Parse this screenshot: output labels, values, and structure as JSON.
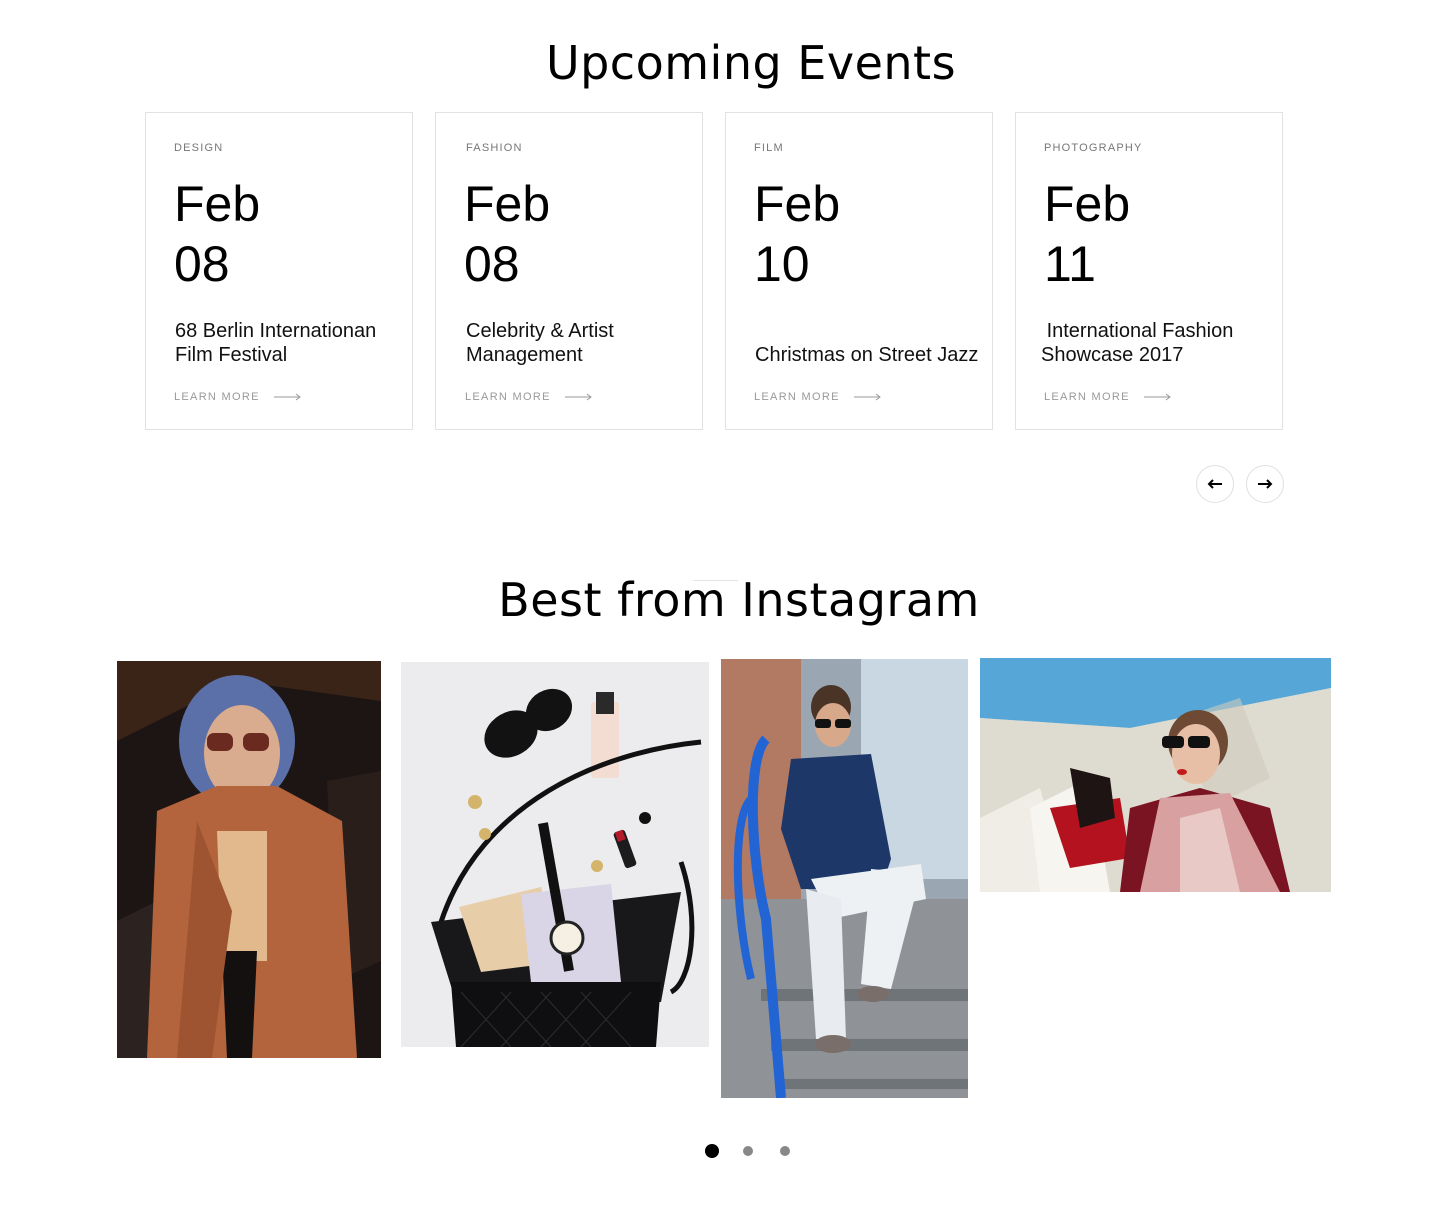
{
  "events": {
    "title": "Upcoming Events",
    "learn_more": "LEARN MORE",
    "items": [
      {
        "category": "DESIGN",
        "month": "Feb",
        "day": "08",
        "title": "68 Berlin Internationan Film Festival"
      },
      {
        "category": "FASHION",
        "month": "Feb",
        "day": "08",
        "title": "Celebrity & Artist Management"
      },
      {
        "category": "FILM",
        "month": "Feb",
        "day": "10",
        "title": "Christmas on Street Jazz"
      },
      {
        "category": "PHOTOGRAPHY",
        "month": "Feb",
        "day": "11",
        "title": " International Fashion Showcase 2017"
      }
    ],
    "prev_icon": "arrow-left-icon",
    "next_icon": "arrow-right-icon"
  },
  "instagram": {
    "title": "Best from Instagram",
    "photos": [
      {
        "subject": "woman-in-coat-photo"
      },
      {
        "subject": "handbag-flatlay-photo"
      },
      {
        "subject": "man-on-stairs-photo"
      },
      {
        "subject": "woman-shopping-photo"
      }
    ],
    "pagination": {
      "pages": 3,
      "active": 1
    }
  },
  "colors": {
    "card_border": "#e2e2e2",
    "muted_text": "#999999",
    "dot_active": "#000000",
    "dot_inactive": "#888888"
  }
}
